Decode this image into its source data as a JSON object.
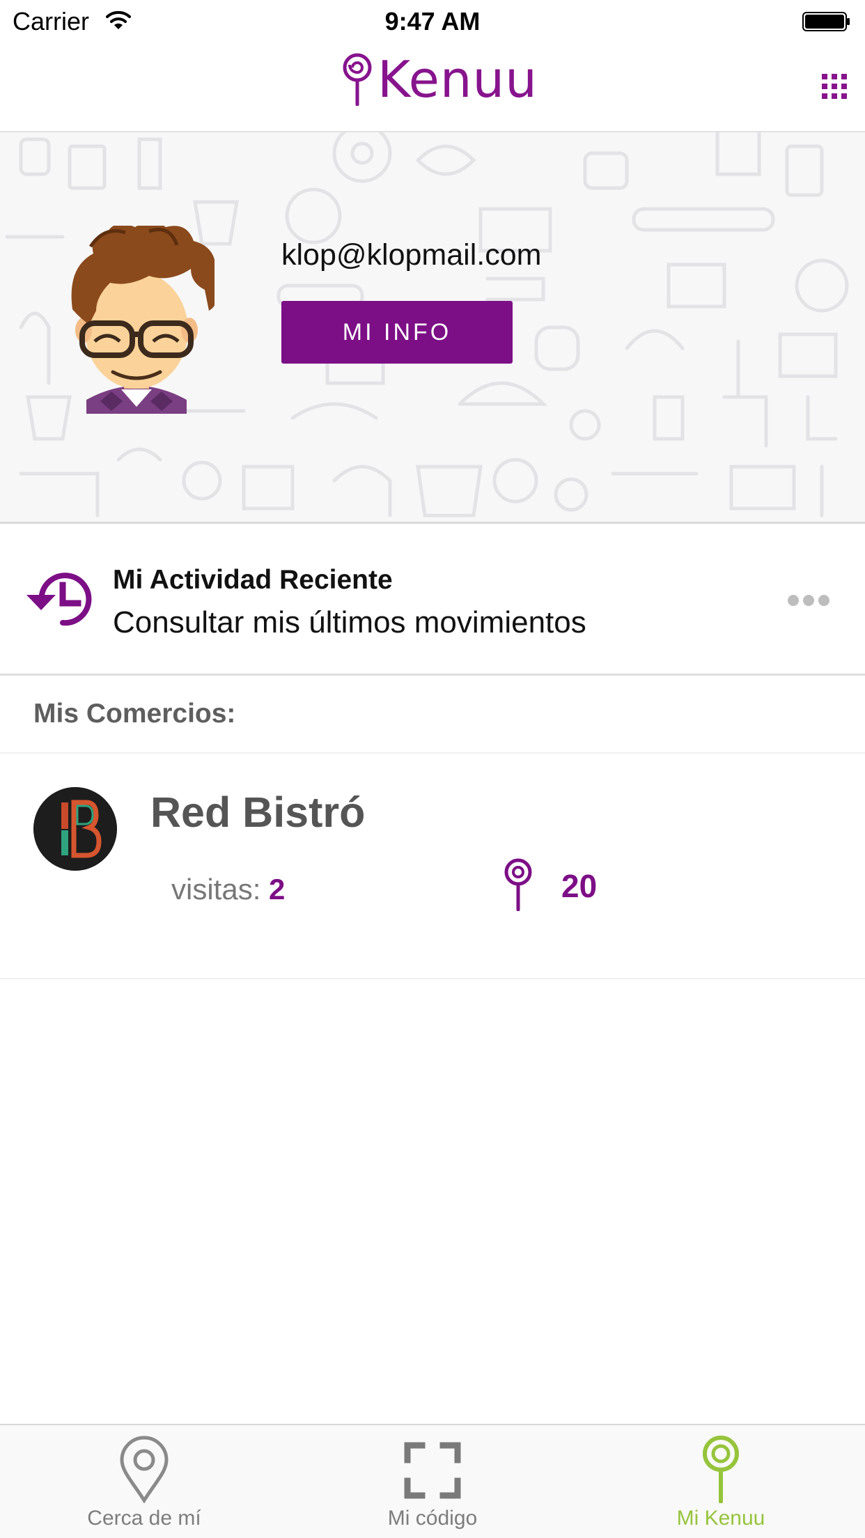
{
  "status_bar": {
    "carrier": "Carrier",
    "time": "9:47 AM"
  },
  "nav": {
    "brand": "Kenuu",
    "menu_icon": "grid-icon"
  },
  "profile": {
    "email": "klop@klopmail.com",
    "info_button": "MI INFO"
  },
  "activity": {
    "title": "Mi Actividad Reciente",
    "subtitle": "Consultar mis últimos movimientos",
    "icon": "history-icon",
    "more_icon": "more-dots-icon"
  },
  "merchants": {
    "section_title": "Mis Comercios:",
    "items": [
      {
        "name": "Red Bistró",
        "visits_label": "visitas:",
        "visits": "2",
        "points": "20"
      }
    ]
  },
  "tabs": [
    {
      "label": "Cerca de mí",
      "icon": "location-pin-icon",
      "active": false
    },
    {
      "label": "Mi código",
      "icon": "scan-frame-icon",
      "active": false
    },
    {
      "label": "Mi Kenuu",
      "icon": "kenuu-lollipop-icon",
      "active": true
    }
  ],
  "colors": {
    "brand": "#7c0e86",
    "active_tab": "#96c43b",
    "inactive_tab": "#7d7d7d"
  }
}
